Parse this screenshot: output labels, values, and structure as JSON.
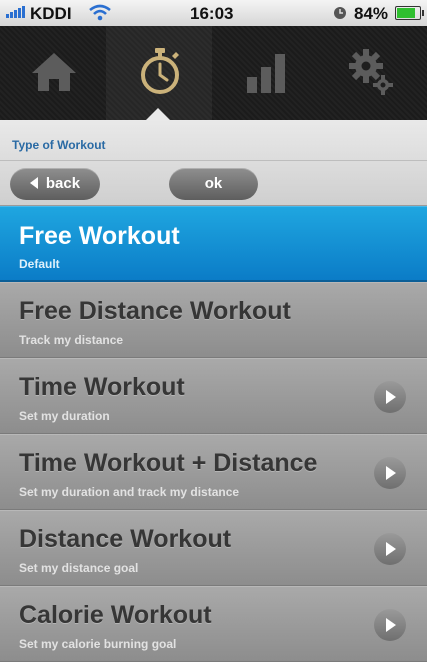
{
  "status_bar": {
    "carrier": "KDDI",
    "time": "16:03",
    "battery": "84%",
    "battery_level": 0.84
  },
  "tabs": [
    {
      "icon": "home-icon"
    },
    {
      "icon": "stopwatch-icon",
      "active": true
    },
    {
      "icon": "bar-chart-icon"
    },
    {
      "icon": "gear-icon"
    }
  ],
  "header": {
    "title": "Type of Workout",
    "back_label": "back",
    "ok_label": "ok"
  },
  "workouts": [
    {
      "title": "Free Workout",
      "subtitle": "Default",
      "selected": true,
      "has_arrow": false
    },
    {
      "title": "Free Distance Workout",
      "subtitle": "Track my distance",
      "selected": false,
      "has_arrow": false
    },
    {
      "title": "Time Workout",
      "subtitle": "Set my duration",
      "selected": false,
      "has_arrow": true
    },
    {
      "title": "Time Workout + Distance",
      "subtitle": "Set my duration and track my distance",
      "selected": false,
      "has_arrow": true
    },
    {
      "title": "Distance Workout",
      "subtitle": "Set my distance goal",
      "selected": false,
      "has_arrow": true
    },
    {
      "title": "Calorie Workout",
      "subtitle": "Set my calorie burning goal",
      "selected": false,
      "has_arrow": true
    }
  ],
  "colors": {
    "accent_blue": "#0b7cc7",
    "header_title": "#2a6aa4"
  }
}
